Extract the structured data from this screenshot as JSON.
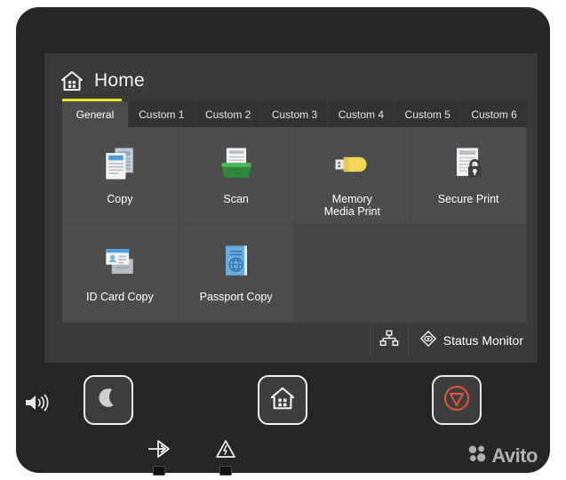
{
  "header": {
    "title": "Home",
    "home_icon": "home-icon",
    "accent_color": "#e8e432"
  },
  "tabs": [
    {
      "label": "General",
      "active": true
    },
    {
      "label": "Custom 1",
      "active": false
    },
    {
      "label": "Custom 2",
      "active": false
    },
    {
      "label": "Custom 3",
      "active": false
    },
    {
      "label": "Custom 4",
      "active": false
    },
    {
      "label": "Custom 5",
      "active": false
    },
    {
      "label": "Custom 6",
      "active": false
    }
  ],
  "tiles": [
    {
      "label": "Copy",
      "icon": "copy-documents-icon",
      "empty": false
    },
    {
      "label": "Scan",
      "icon": "scanner-icon",
      "empty": false
    },
    {
      "label": "Memory\nMedia Print",
      "icon": "usb-drive-icon",
      "empty": false
    },
    {
      "label": "Secure Print",
      "icon": "document-lock-icon",
      "empty": false
    },
    {
      "label": "ID Card Copy",
      "icon": "id-card-icon",
      "empty": false
    },
    {
      "label": "Passport Copy",
      "icon": "passport-icon",
      "empty": false
    },
    {
      "label": "",
      "icon": "",
      "empty": true
    },
    {
      "label": "",
      "icon": "",
      "empty": true
    }
  ],
  "statusbar": {
    "network_icon": "network-icon",
    "status_monitor_icon": "status-monitor-icon",
    "status_monitor_label": "Status Monitor"
  },
  "hardware": {
    "speaker_icon": "speaker-volume-icon",
    "sleep_icon": "moon-sleep-icon",
    "home_icon": "home-button-icon",
    "stop_icon": "stop-icon",
    "stop_color": "#d9533f"
  },
  "indicators": [
    {
      "name": "data-indicator",
      "icon": "arrow-data-icon"
    },
    {
      "name": "error-indicator",
      "icon": "warning-triangle-icon"
    }
  ],
  "watermark": {
    "text": "Avito",
    "logo_icon": "avito-logo-icon"
  },
  "colors": {
    "bezel": "#262626",
    "screen": "#3a3a3a",
    "tile": "#4d4d4d",
    "tab_inactive": "#333333",
    "tab_active": "#4d4d4d",
    "accent_yellow": "#e8e432",
    "copy_blue": "#4a9fe0",
    "scan_green": "#3aa648",
    "usb_yellow": "#f2d857",
    "passport_blue": "#6aaee0"
  }
}
